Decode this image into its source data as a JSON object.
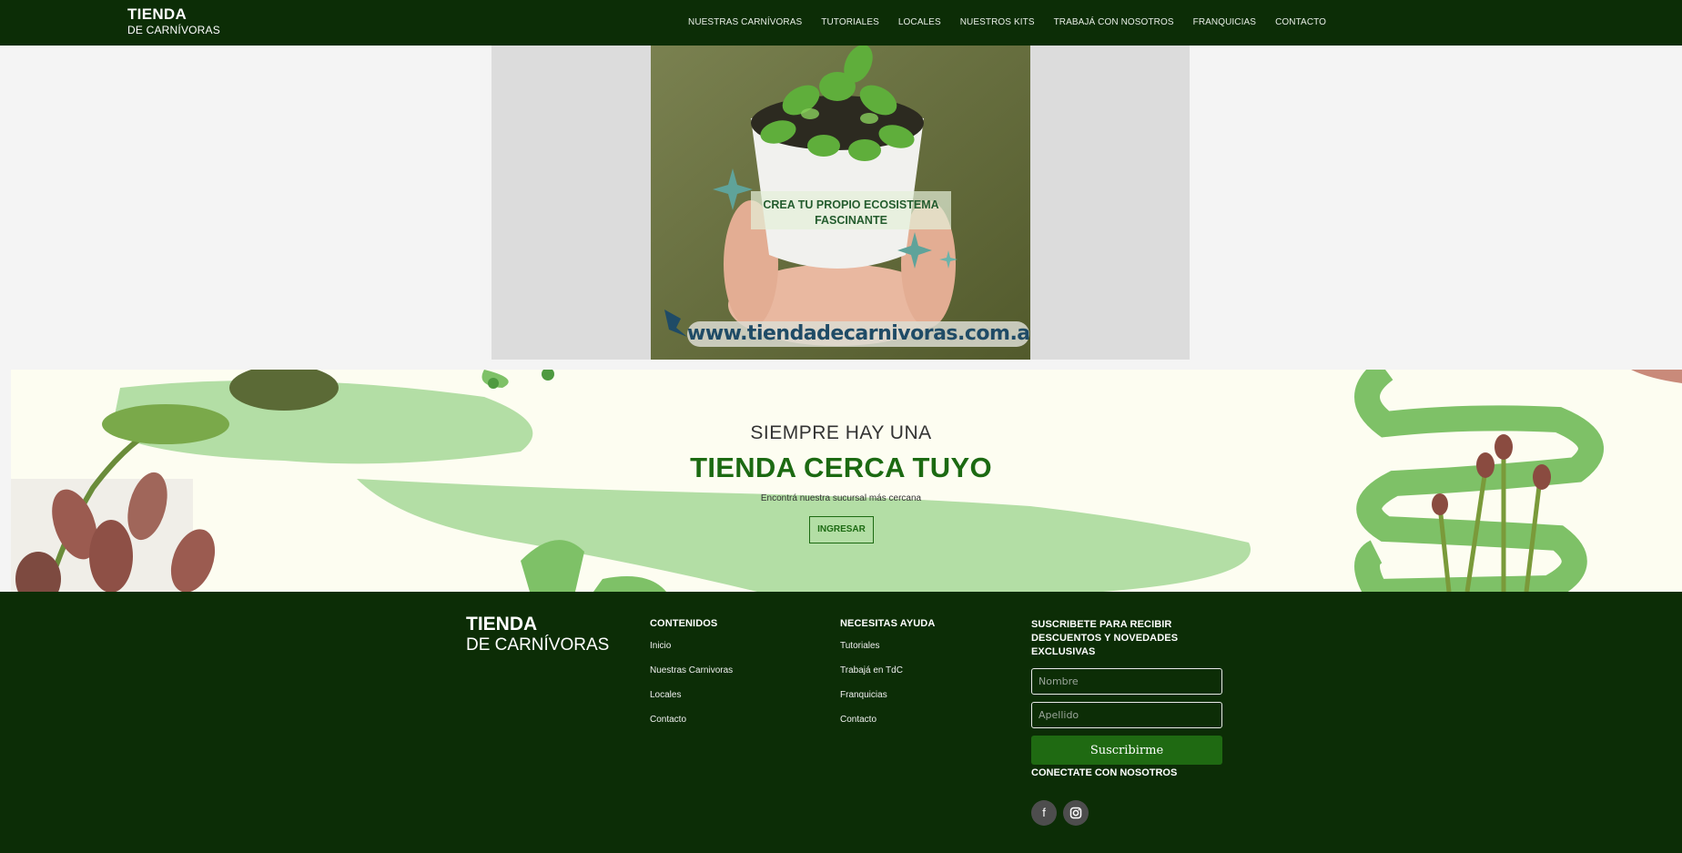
{
  "header": {
    "logo_line1": "TIENDA",
    "logo_line2": "DE CARNÍVORAS",
    "nav": [
      "NUESTRAS CARNÍVORAS",
      "TUTORIALES",
      "LOCALES",
      "NUESTROS KITS",
      "TRABAJÁ CON NOSOTROS",
      "FRANQUICIAS",
      "CONTACTO"
    ]
  },
  "hero": {
    "caption": "CREA TU PROPIO ECOSISTEMA FASCINANTE",
    "url": "www.tiendadecarnivoras.com.ar"
  },
  "stores": {
    "pre_title": "SIEMPRE HAY UNA",
    "title": "TIENDA CERCA TUYO",
    "subtitle": "Encontrá nuestra sucursal más cercana",
    "button": "INGRESAR"
  },
  "footer": {
    "logo_line1": "TIENDA",
    "logo_line2": "DE CARNÍVORAS",
    "contents": {
      "heading": "CONTENIDOS",
      "links": [
        "Inicio",
        "Nuestras Carnivoras",
        "Locales",
        "Contacto"
      ]
    },
    "help": {
      "heading": "NECESITAS AYUDA",
      "links": [
        "Tutoriales",
        "Trabajá en TdC",
        "Franquicias",
        "Contacto"
      ]
    },
    "newsletter": {
      "heading": "SUSCRIBETE PARA RECIBIR DESCUENTOS Y NOVEDADES EXCLUSIVAS",
      "name_placeholder": "Nombre",
      "lastname_placeholder": "Apellido",
      "submit": "Suscribirme"
    },
    "connect": "CONECTATE CON NOSOTROS",
    "social_icons": [
      "facebook-icon",
      "instagram-icon"
    ]
  },
  "colors": {
    "dark_green": "#0c2d06",
    "brand_green": "#1c6a12",
    "light_green": "#b3dea5",
    "cream": "#fdfdf1"
  }
}
